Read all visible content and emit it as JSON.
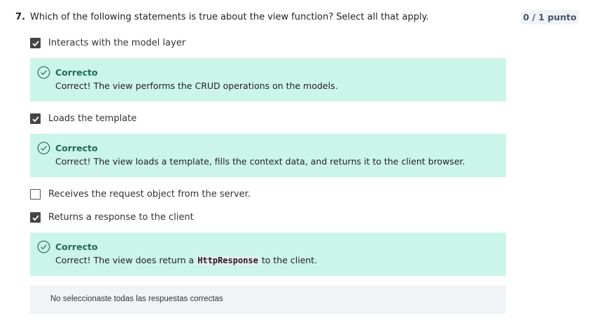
{
  "question": {
    "number": "7.",
    "text": "Which of the following statements is true about the view function? Select all that apply.",
    "score": "0 / 1 punto"
  },
  "options": [
    {
      "label": "Interacts with the model layer",
      "checked": true,
      "feedback": {
        "title": "Correcto",
        "text": "Correct! The view performs the CRUD operations on the models."
      }
    },
    {
      "label": "Loads the template",
      "checked": true,
      "feedback": {
        "title": "Correcto",
        "text": "Correct! The view loads a template, fills the context data, and returns it to the client browser."
      }
    },
    {
      "label": "Receives the request object from the server.",
      "checked": false
    },
    {
      "label": "Returns a response to the client",
      "checked": true,
      "feedback": {
        "title": "Correcto",
        "text_before": "Correct! The view does return a ",
        "code": "HttpResponse",
        "text_after": " to the client."
      }
    }
  ],
  "summary": "No seleccionaste todas las respuestas correctas",
  "colors": {
    "feedback_bg": "#ccf5e9",
    "success_green": "#1e6b53",
    "summary_bg": "#f1f3f6",
    "checkbox_fill": "#454545"
  },
  "icons": {
    "checked": "checkmark-icon",
    "feedback": "circle-check-icon"
  }
}
